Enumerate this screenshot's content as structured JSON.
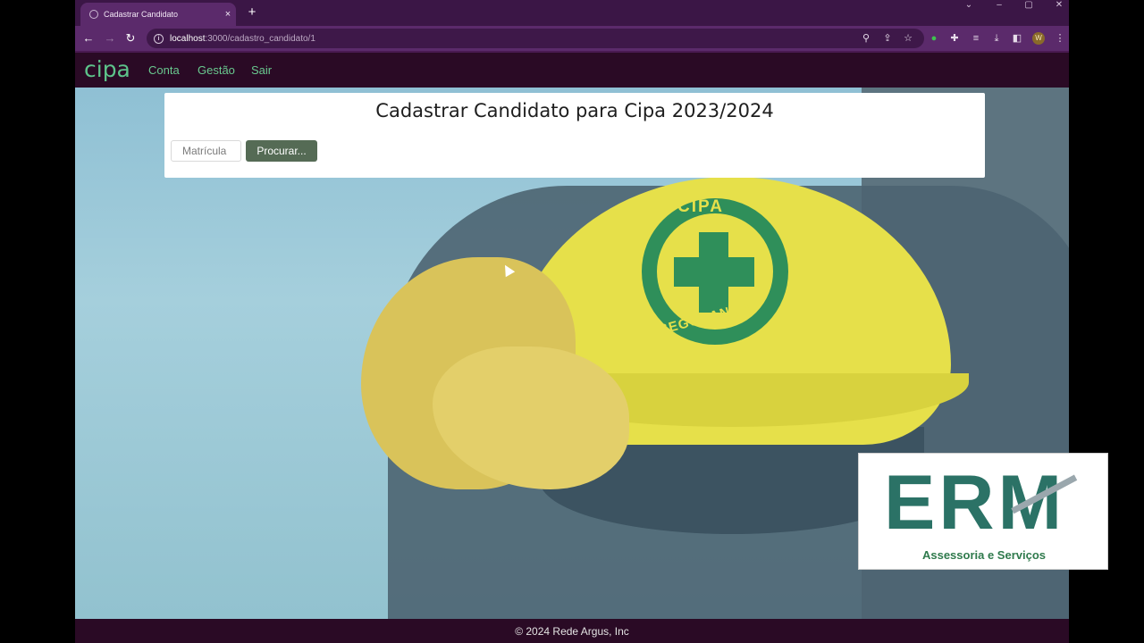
{
  "browser": {
    "tab_title": "Cadastrar Candidato",
    "tab_close": "×",
    "new_tab": "+",
    "url_host": "localhost",
    "url_path": ":3000/cadastro_candidato/1",
    "profile_initial": "W"
  },
  "app": {
    "brand": "cipa",
    "nav": [
      "Conta",
      "Gestão",
      "Sair"
    ]
  },
  "form": {
    "title": "Cadastrar Candidato para Cipa 2023/2024",
    "matricula_placeholder": "Matrícula",
    "search_button": "Procurar..."
  },
  "hero": {
    "logo_top": "CIPA",
    "logo_bottom": "SEGURANÇA"
  },
  "footer": {
    "text": "© 2024 Rede Argus, Inc"
  },
  "watermark": {
    "title": "ERM",
    "subtitle": "Assessoria e Serviços"
  },
  "colors": {
    "browser_frame": "#5b2a6b",
    "app_nav": "#2a0a25",
    "brand_green": "#5dc38a",
    "button": "#556b55"
  }
}
